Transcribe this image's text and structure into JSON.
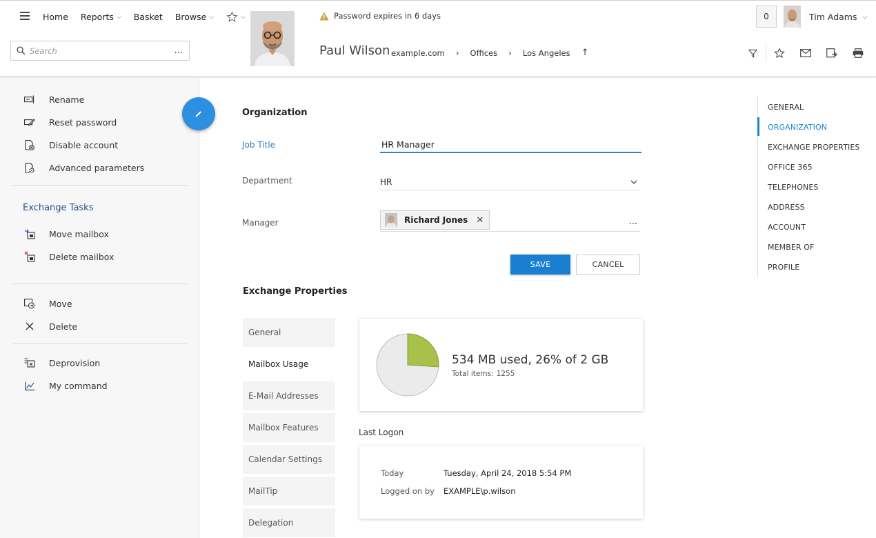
{
  "nav": {
    "home": "Home",
    "reports": "Reports",
    "basket": "Basket",
    "browse": "Browse"
  },
  "search": {
    "placeholder": "Search",
    "more": "..."
  },
  "warning": {
    "text": "Password expires in 6 days"
  },
  "object": {
    "name": "Paul Wilson",
    "breadcrumb": [
      "example.com",
      "Offices",
      "Los Angeles"
    ]
  },
  "user": {
    "count": "0",
    "name": "Tim Adams"
  },
  "left_panel": {
    "actions": [
      "Rename",
      "Reset password",
      "Disable account",
      "Advanced parameters"
    ],
    "exchange_heading": "Exchange Tasks",
    "exchange_tasks": [
      "Move mailbox",
      "Delete mailbox"
    ],
    "object_actions": [
      "Move",
      "Delete"
    ],
    "other": [
      "Deprovision",
      "My command"
    ]
  },
  "organization": {
    "title": "Organization",
    "job_title_label": "Job Title",
    "job_title_value": "HR Manager",
    "department_label": "Department",
    "department_value": "HR",
    "manager_label": "Manager",
    "manager_value": "Richard Jones",
    "more": "...",
    "save": "SAVE",
    "cancel": "CANCEL"
  },
  "exchange": {
    "title": "Exchange Properties",
    "tabs": [
      "General",
      "Mailbox Usage",
      "E-Mail Addresses",
      "Mailbox Features",
      "Calendar Settings",
      "MailTip",
      "Delegation"
    ],
    "active_tab": 1,
    "usage": {
      "summary": "534 MB used, 26% of 2 GB",
      "total_label": "Total items:",
      "total_value": "1255",
      "used_fraction": 0.26,
      "used_color": "#a9c04a",
      "free_color": "#ebebeb"
    },
    "last_logon_title": "Last Logon",
    "last_logon": {
      "today_label": "Today",
      "today_value": "Tuesday, April 24, 2018 5:54 PM",
      "logged_label": "Logged on by",
      "logged_value": "EXAMPLE\\p.wilson"
    }
  },
  "right_nav": {
    "items": [
      "GENERAL",
      "ORGANIZATION",
      "EXCHANGE PROPERTIES",
      "OFFICE 365",
      "TELEPHONES",
      "ADDRESS",
      "ACCOUNT",
      "MEMBER OF",
      "PROFILE"
    ],
    "active": 1,
    "accent": "#1a85cf"
  }
}
